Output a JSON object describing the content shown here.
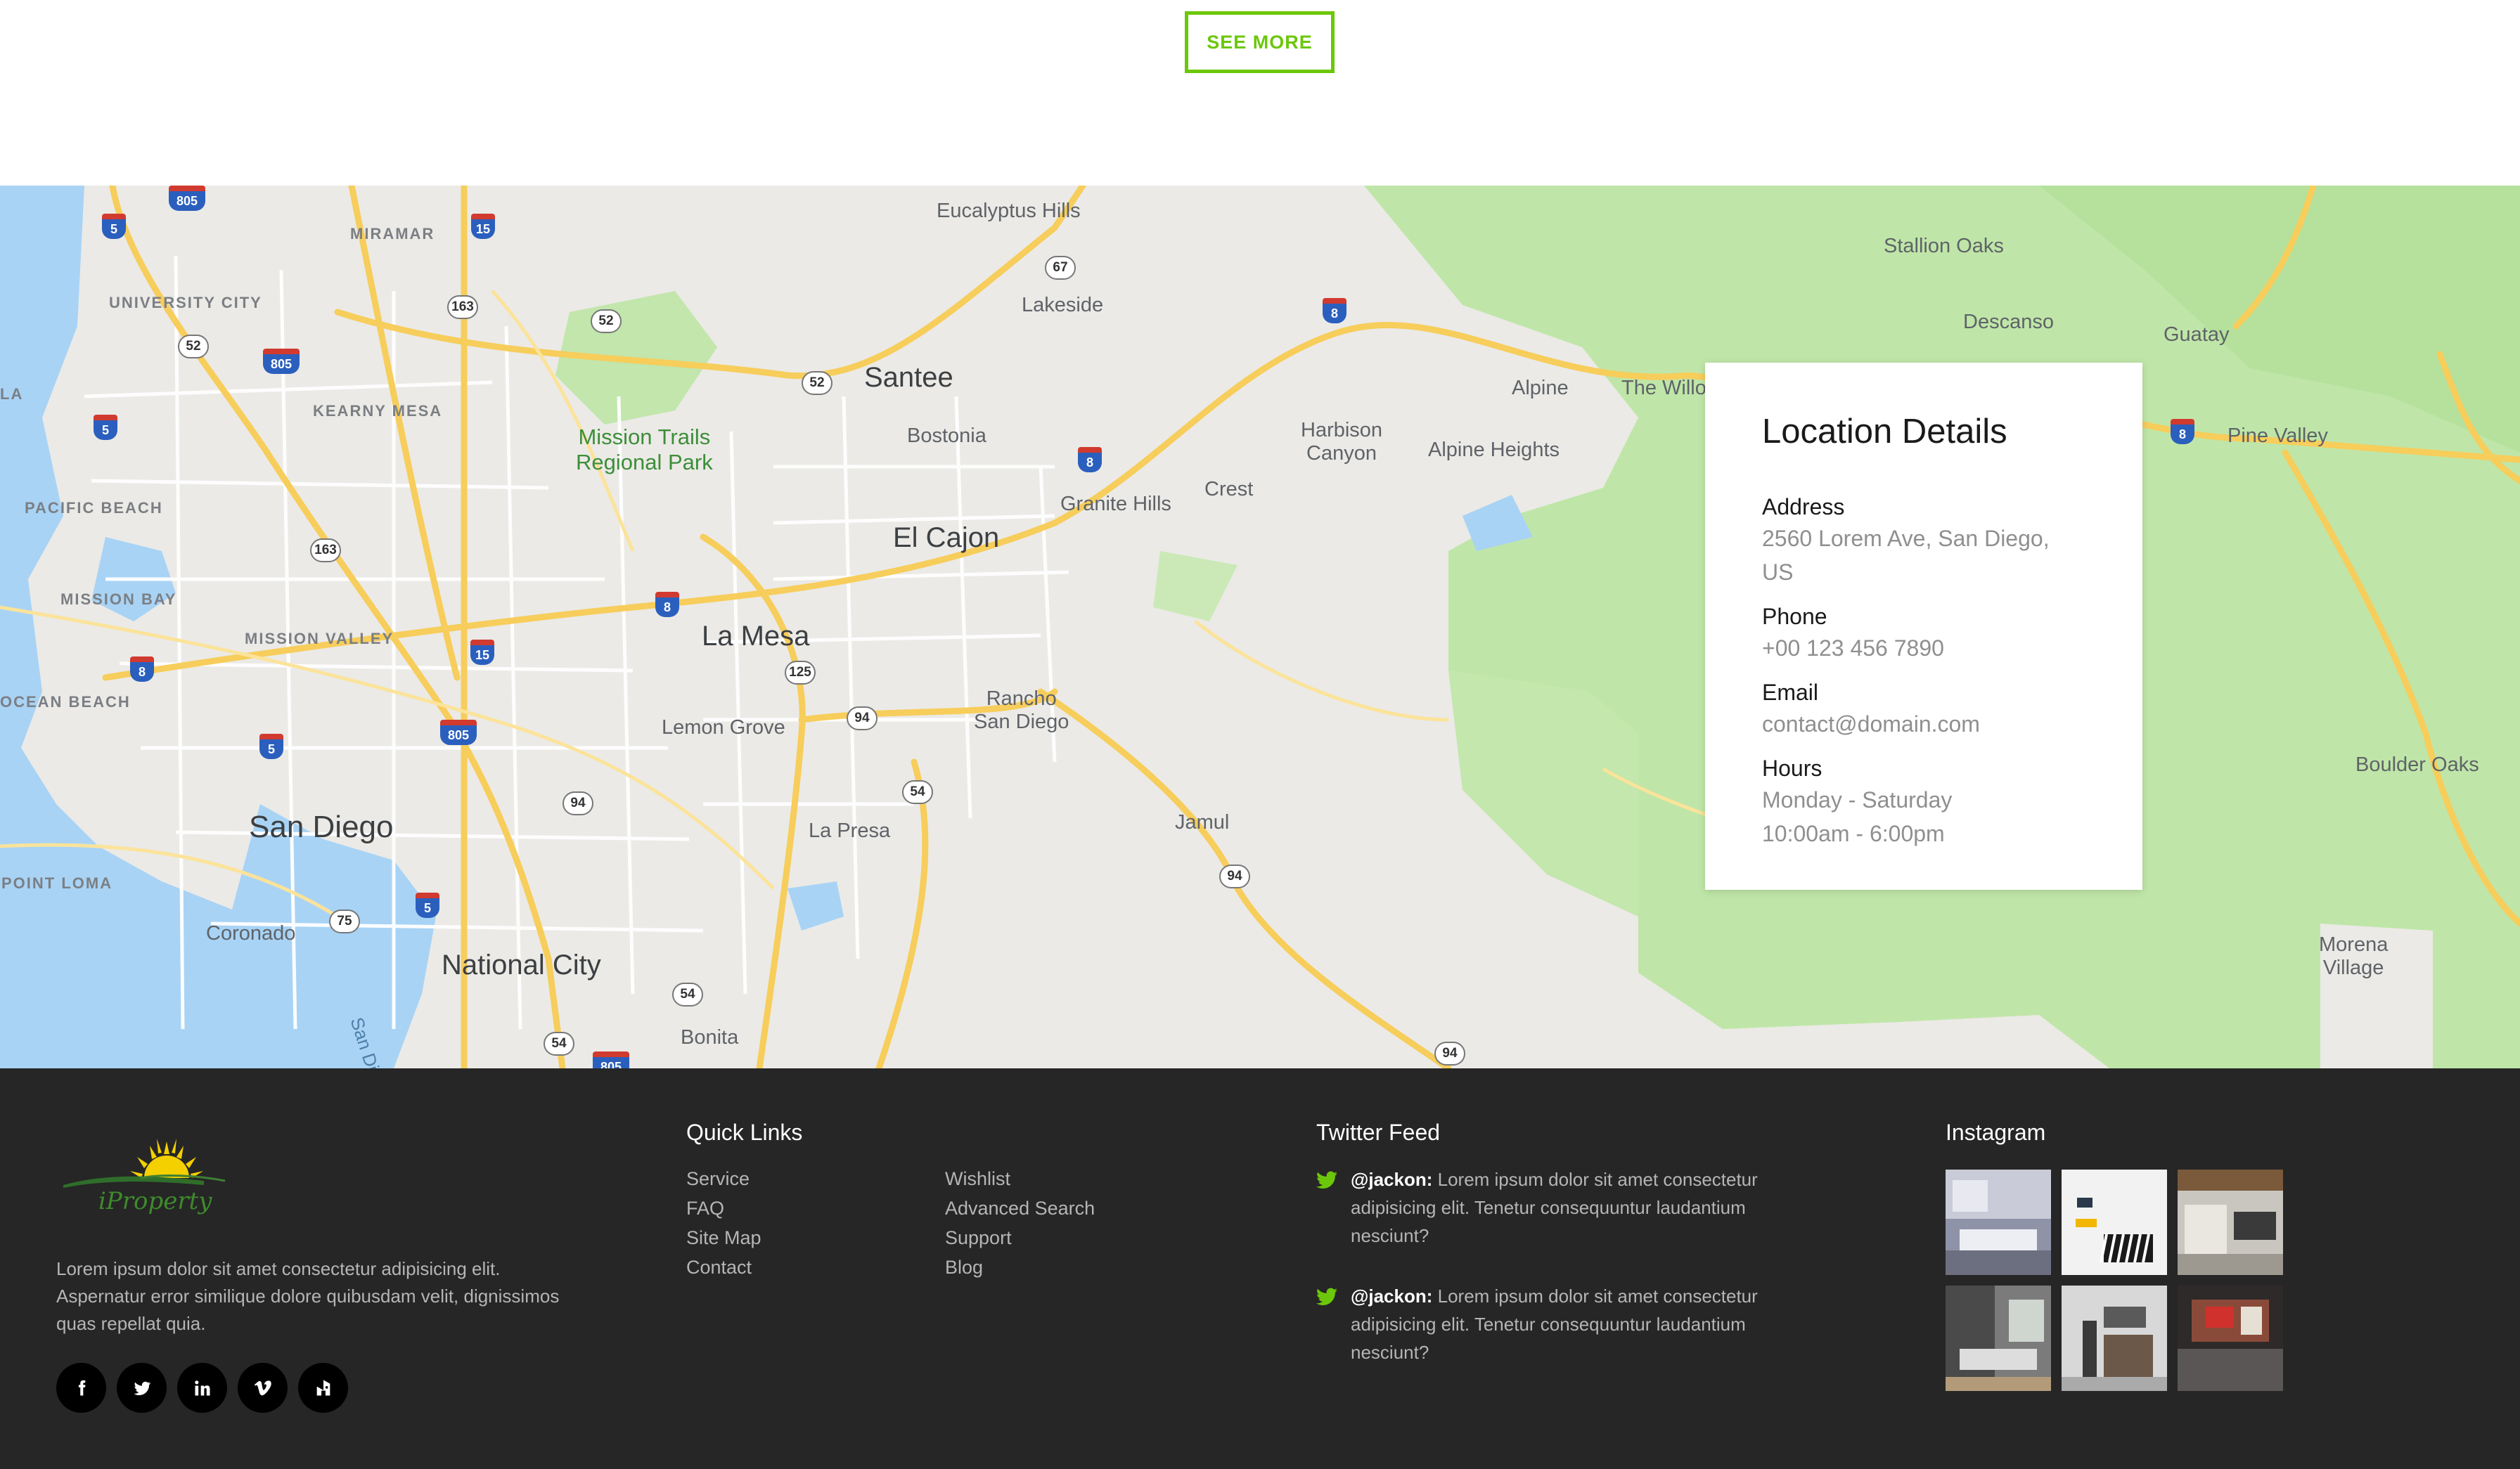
{
  "see_more": {
    "label": "SEE MORE"
  },
  "map": {
    "cities": [
      "San Diego",
      "La Mesa",
      "El Cajon",
      "Santee",
      "National City",
      "Lemon Grove",
      "La Presa",
      "Bonita",
      "Coronado",
      "Bostonia",
      "Lakeside",
      "Alpine",
      "Jamul",
      "Crest",
      "Granite Hills",
      "Alpine Heights",
      "Descanso",
      "Guatay",
      "Pine Valley",
      "Boulder Oaks",
      "Stallion Oaks",
      "The Willo"
    ],
    "multiline_places": [
      "Eucalyptus\nHills",
      "Harbison\nCanyon",
      "Rancho\nSan Diego",
      "Morena\nVillage"
    ],
    "neighborhoods": [
      "MIRAMAR",
      "UNIVERSITY CITY",
      "KEARNY MESA",
      "PACIFIC BEACH",
      "MISSION BAY",
      "MISSION VALLEY",
      "OCEAN BEACH",
      "POINT LOMA",
      "LA"
    ],
    "park": "Mission Trails\nRegional Park",
    "water": "San Dieg",
    "route_shields": [
      "805",
      "5",
      "15",
      "163",
      "52",
      "805",
      "5",
      "163",
      "8",
      "15",
      "805",
      "5",
      "125",
      "94",
      "54",
      "94",
      "75",
      "5",
      "54",
      "54",
      "805",
      "67",
      "8",
      "52",
      "8",
      "8",
      "94",
      "8"
    ]
  },
  "location": {
    "title": "Location Details",
    "address_label": "Address",
    "address": "2560 Lorem Ave, San Diego, US",
    "phone_label": "Phone",
    "phone": "+00 123 456 7890",
    "email_label": "Email",
    "email": "contact@domain.com",
    "hours_label": "Hours",
    "hours_days": "Monday - Saturday",
    "hours_time": "10:00am - 6:00pm"
  },
  "footer": {
    "logo_text": "iProperty",
    "about": "Lorem ipsum dolor sit amet consectetur adipisicing elit. Aspernatur error similique dolore quibusdam velit, dignissimos quas repellat quia.",
    "socials": [
      "facebook-icon",
      "twitter-icon",
      "linkedin-icon",
      "vimeo-icon",
      "houzz-icon"
    ],
    "quick_links_title": "Quick Links",
    "quick_links_col1": [
      "Service",
      "FAQ",
      "Site Map",
      "Contact"
    ],
    "quick_links_col2": [
      "Wishlist",
      "Advanced Search",
      "Support",
      "Blog"
    ],
    "twitter_title": "Twitter Feed",
    "tweets": [
      {
        "handle": "@jackon:",
        "text": " Lorem ipsum dolor sit amet consectetur adipisicing elit. Tenetur consequuntur laudantium nesciunt?"
      },
      {
        "handle": "@jackon:",
        "text": " Lorem ipsum dolor sit amet consectetur adipisicing elit. Tenetur consequuntur laudantium nesciunt?"
      }
    ],
    "instagram_title": "Instagram"
  },
  "colors": {
    "accent": "#6cc70a",
    "footer_bg": "#262626",
    "map_land": "#ebeae6",
    "map_park": "#b8e3a0",
    "map_water": "#a8d3f5",
    "map_road": "#f8d77a"
  }
}
